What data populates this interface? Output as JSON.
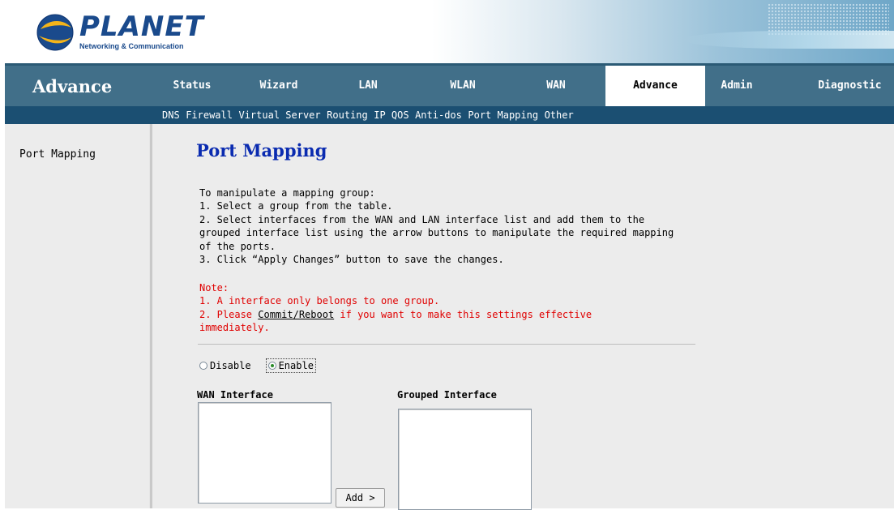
{
  "logo": {
    "name": "PLANET",
    "subtitle": "Networking & Communication",
    "colors": {
      "primary": "#1a4a8c",
      "accent": "#f4b41a"
    }
  },
  "nav": {
    "section": "Advance",
    "tabs": [
      {
        "label": "Status"
      },
      {
        "label": "Wizard"
      },
      {
        "label": "LAN"
      },
      {
        "label": "WLAN"
      },
      {
        "label": "WAN"
      },
      {
        "label": "Advance",
        "active": true
      },
      {
        "label": "Admin"
      },
      {
        "label": "Diagnostic"
      }
    ],
    "colors": {
      "bar": "#416f89",
      "subbar": "#1b4f72"
    }
  },
  "subnav": {
    "items": [
      "DNS",
      "Firewall",
      "Virtual Server",
      "Routing",
      "IP QOS",
      "Anti-dos",
      "Port Mapping",
      "Other"
    ]
  },
  "sidebar": {
    "items": [
      {
        "label": "Port Mapping"
      }
    ]
  },
  "page": {
    "title": "Port Mapping",
    "description": [
      "To manipulate a mapping group:",
      "1. Select a group from the table.",
      "2. Select interfaces from the WAN and LAN interface list and add them to the grouped interface list using the arrow buttons to manipulate the required mapping of the ports.",
      "3. Click “Apply Changes” button to save the changes."
    ],
    "note": {
      "heading": "Note:",
      "line1": "1. A interface only belongs to one group.",
      "line2_prefix": "2. Please ",
      "line2_link": "Commit/Reboot",
      "line2_suffix": " if you want to make this settings effective immediately."
    },
    "mode": {
      "options": [
        {
          "label": "Disable"
        },
        {
          "label": "Enable"
        }
      ],
      "selected": "Enable"
    },
    "wan_interface_label": "WAN Interface",
    "grouped_interface_label": "Grouped Interface",
    "add_button": "Add >"
  }
}
